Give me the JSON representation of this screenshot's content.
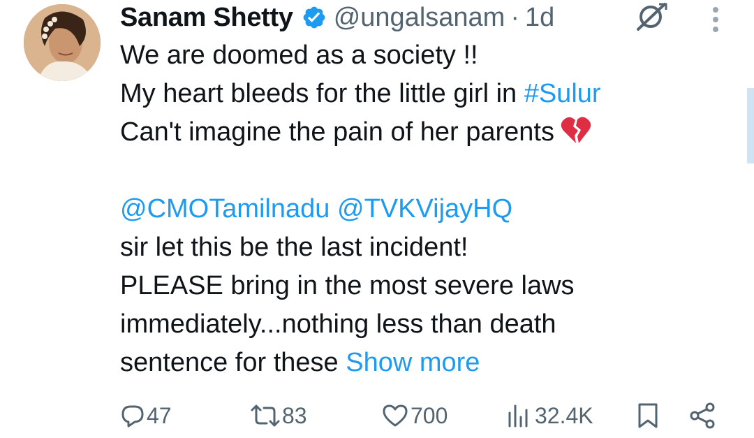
{
  "author": {
    "name": "Sanam Shetty",
    "handle": "@ungalsanam",
    "separator": "·",
    "time": "1d"
  },
  "tweet": {
    "line1": "We are doomed as a society !!",
    "line2_text": "My heart bleeds for the little girl in ",
    "line2_hashtag": "#Sulur",
    "line3_text": "Can't imagine the pain of her parents",
    "mention1": "@CMOTamilnadu",
    "mention2": "@TVKVijayHQ",
    "line5": "sir let this be the last incident!",
    "line6": "PLEASE bring in the most severe laws",
    "line7": "immediately...nothing less than death",
    "line8_text": "sentence for these ",
    "show_more": "Show more"
  },
  "actions": {
    "replies": "47",
    "reposts": "83",
    "likes": "700",
    "views": "32.4K"
  },
  "colors": {
    "link": "#1d9bf0",
    "muted": "#536471",
    "text": "#0f1419",
    "verified": "#1d9bf0"
  },
  "icons": [
    "verified-badge-icon",
    "grok-icon",
    "more-options-icon",
    "broken-heart-emoji",
    "reply-icon",
    "repost-icon",
    "like-icon",
    "views-icon",
    "bookmark-icon",
    "share-icon"
  ]
}
